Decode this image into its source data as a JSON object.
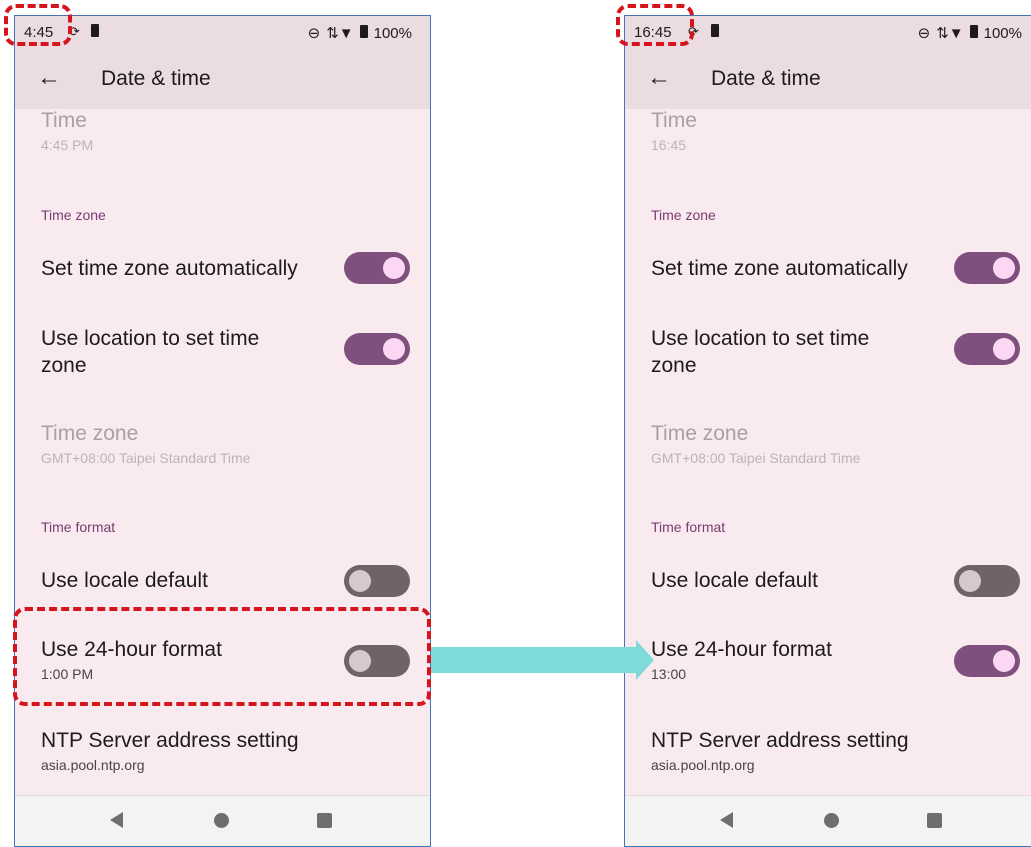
{
  "left": {
    "status_time": "4:45",
    "status_battery": "100%",
    "title": "Date & time",
    "time_title": "Time",
    "time_value": "4:45 PM",
    "section_timezone": "Time zone",
    "auto_tz_label": "Set time zone automatically",
    "location_tz_label": "Use location to set time zone",
    "tz_title": "Time zone",
    "tz_value": "GMT+08:00 Taipei Standard Time",
    "section_format": "Time format",
    "locale_default_label": "Use locale default",
    "hour24_label": "Use 24-hour format",
    "hour24_value": "1:00 PM",
    "ntp_label": "NTP Server address setting",
    "ntp_value": "asia.pool.ntp.org",
    "auto_tz_on": true,
    "location_tz_on": true,
    "locale_default_on": false,
    "hour24_on": false
  },
  "right": {
    "status_time": "16:45",
    "status_battery": "100%",
    "title": "Date & time",
    "time_title": "Time",
    "time_value": "16:45",
    "section_timezone": "Time zone",
    "auto_tz_label": "Set time zone automatically",
    "location_tz_label": "Use location to set time zone",
    "tz_title": "Time zone",
    "tz_value": "GMT+08:00 Taipei Standard Time",
    "section_format": "Time format",
    "locale_default_label": "Use locale default",
    "hour24_label": "Use 24-hour format",
    "hour24_value": "13:00",
    "ntp_label": "NTP Server address setting",
    "ntp_value": "asia.pool.ntp.org",
    "auto_tz_on": true,
    "location_tz_on": true,
    "locale_default_on": false,
    "hour24_on": true
  },
  "colors": {
    "toggle_on": "#7f4f7e",
    "toggle_off": "#6f6369",
    "highlight": "#d6141b",
    "arrow": "#7fdada",
    "section_header": "#7b3b73"
  }
}
